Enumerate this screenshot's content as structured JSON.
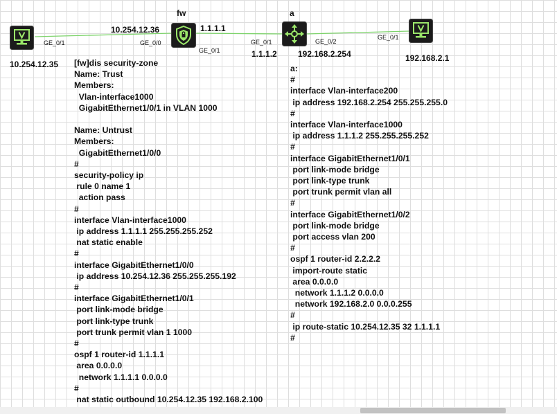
{
  "topology": {
    "devices": [
      {
        "id": "pc-left",
        "kind": "pc",
        "icon": "pc-monitor-icon",
        "ip": "10.254.12.35"
      },
      {
        "id": "fw",
        "kind": "firewall",
        "icon": "firewall-shield-icon",
        "name": "fw",
        "ip_left": "10.254.12.36",
        "ip_right": "1.1.1.1"
      },
      {
        "id": "a",
        "kind": "router",
        "icon": "router-arrows-icon",
        "name": "a",
        "ip_left": "1.1.1.2",
        "ip_right": "192.168.2.254"
      },
      {
        "id": "pc-right",
        "kind": "pc",
        "icon": "pc-monitor-icon",
        "ip": "192.168.2.1"
      }
    ],
    "ports": {
      "pc_left": "GE_0/1",
      "fw_left": "GE_0/0",
      "fw_right": "GE_0/1",
      "a_left": "GE_0/1",
      "a_right": "GE_0/2",
      "pc_right": "GE_0/1"
    },
    "colors": {
      "link": "#7dd36b",
      "device_bg": "#1b1b1b",
      "icon_fg": "#9be76a"
    }
  },
  "fw_config": [
    "[fw]dis security-zone",
    "Name: Trust",
    "Members:",
    "  Vlan-interface1000",
    "  GigabitEthernet1/0/1 in VLAN 1000",
    "",
    "Name: Untrust",
    "Members:",
    "  GigabitEthernet1/0/0",
    "#",
    "security-policy ip",
    " rule 0 name 1",
    "  action pass",
    "#",
    "interface Vlan-interface1000",
    " ip address 1.1.1.1 255.255.255.252",
    " nat static enable",
    "#",
    "interface GigabitEthernet1/0/0",
    " ip address 10.254.12.36 255.255.255.192",
    "#",
    "interface GigabitEthernet1/0/1",
    " port link-mode bridge",
    " port link-type trunk",
    " port trunk permit vlan 1 1000",
    "#",
    "ospf 1 router-id 1.1.1.1",
    " area 0.0.0.0",
    "  network 1.1.1.1 0.0.0.0",
    "#",
    " nat static outbound 10.254.12.35 192.168.2.100"
  ],
  "a_config": [
    "a:",
    "#",
    "interface Vlan-interface200",
    " ip address 192.168.2.254 255.255.255.0",
    "#",
    "interface Vlan-interface1000",
    " ip address 1.1.1.2 255.255.255.252",
    "#",
    "interface GigabitEthernet1/0/1",
    " port link-mode bridge",
    " port link-type trunk",
    " port trunk permit vlan all",
    "#",
    "interface GigabitEthernet1/0/2",
    " port link-mode bridge",
    " port access vlan 200",
    "#",
    "ospf 1 router-id 2.2.2.2",
    " import-route static",
    " area 0.0.0.0",
    "  network 1.1.1.2 0.0.0.0",
    "  network 192.168.2.0 0.0.0.255",
    "#",
    " ip route-static 10.254.12.35 32 1.1.1.1",
    "#"
  ]
}
